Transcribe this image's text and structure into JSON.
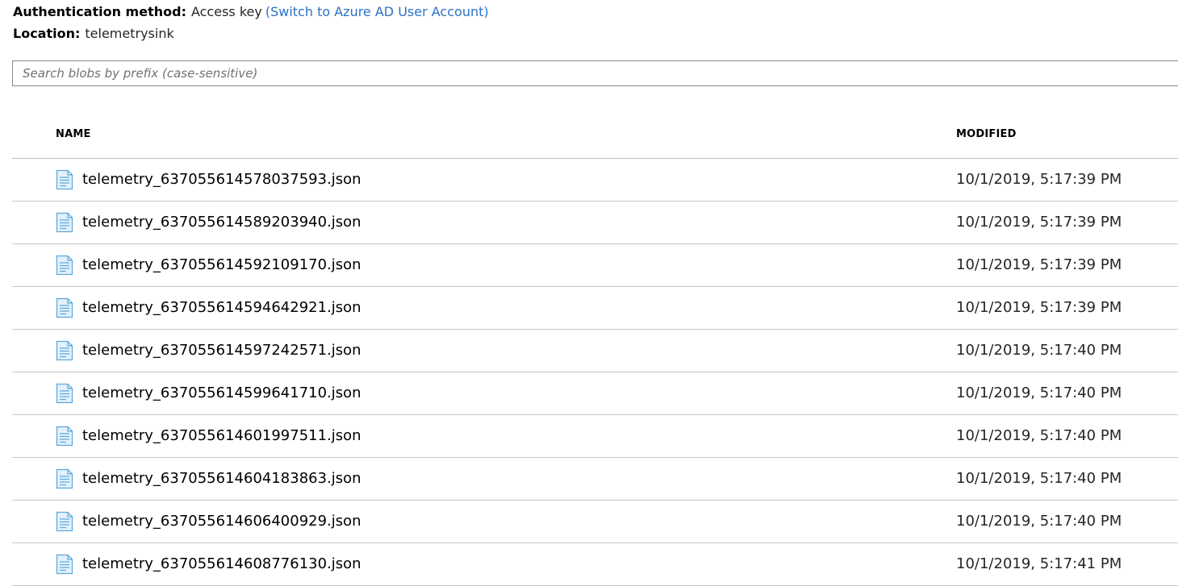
{
  "auth": {
    "label": "Authentication method:",
    "value": "Access key",
    "switch_link": "(Switch to Azure AD User Account)"
  },
  "location": {
    "label": "Location:",
    "value": "telemetrysink"
  },
  "search": {
    "placeholder": "Search blobs by prefix (case-sensitive)",
    "value": ""
  },
  "table": {
    "columns": {
      "name": "NAME",
      "modified": "MODIFIED"
    },
    "rows": [
      {
        "icon": "json-file-icon",
        "name": "telemetry_637055614578037593.json",
        "modified": "10/1/2019, 5:17:39 PM"
      },
      {
        "icon": "json-file-icon",
        "name": "telemetry_637055614589203940.json",
        "modified": "10/1/2019, 5:17:39 PM"
      },
      {
        "icon": "json-file-icon",
        "name": "telemetry_637055614592109170.json",
        "modified": "10/1/2019, 5:17:39 PM"
      },
      {
        "icon": "json-file-icon",
        "name": "telemetry_637055614594642921.json",
        "modified": "10/1/2019, 5:17:39 PM"
      },
      {
        "icon": "json-file-icon",
        "name": "telemetry_637055614597242571.json",
        "modified": "10/1/2019, 5:17:40 PM"
      },
      {
        "icon": "json-file-icon",
        "name": "telemetry_637055614599641710.json",
        "modified": "10/1/2019, 5:17:40 PM"
      },
      {
        "icon": "json-file-icon",
        "name": "telemetry_637055614601997511.json",
        "modified": "10/1/2019, 5:17:40 PM"
      },
      {
        "icon": "json-file-icon",
        "name": "telemetry_637055614604183863.json",
        "modified": "10/1/2019, 5:17:40 PM"
      },
      {
        "icon": "json-file-icon",
        "name": "telemetry_637055614606400929.json",
        "modified": "10/1/2019, 5:17:40 PM"
      },
      {
        "icon": "json-file-icon",
        "name": "telemetry_637055614608776130.json",
        "modified": "10/1/2019, 5:17:41 PM"
      }
    ]
  },
  "colors": {
    "link": "#2a73c5",
    "icon_fill": "#e3f1fb",
    "icon_stroke": "#5aa7dc",
    "divider": "#c6c6c6"
  }
}
